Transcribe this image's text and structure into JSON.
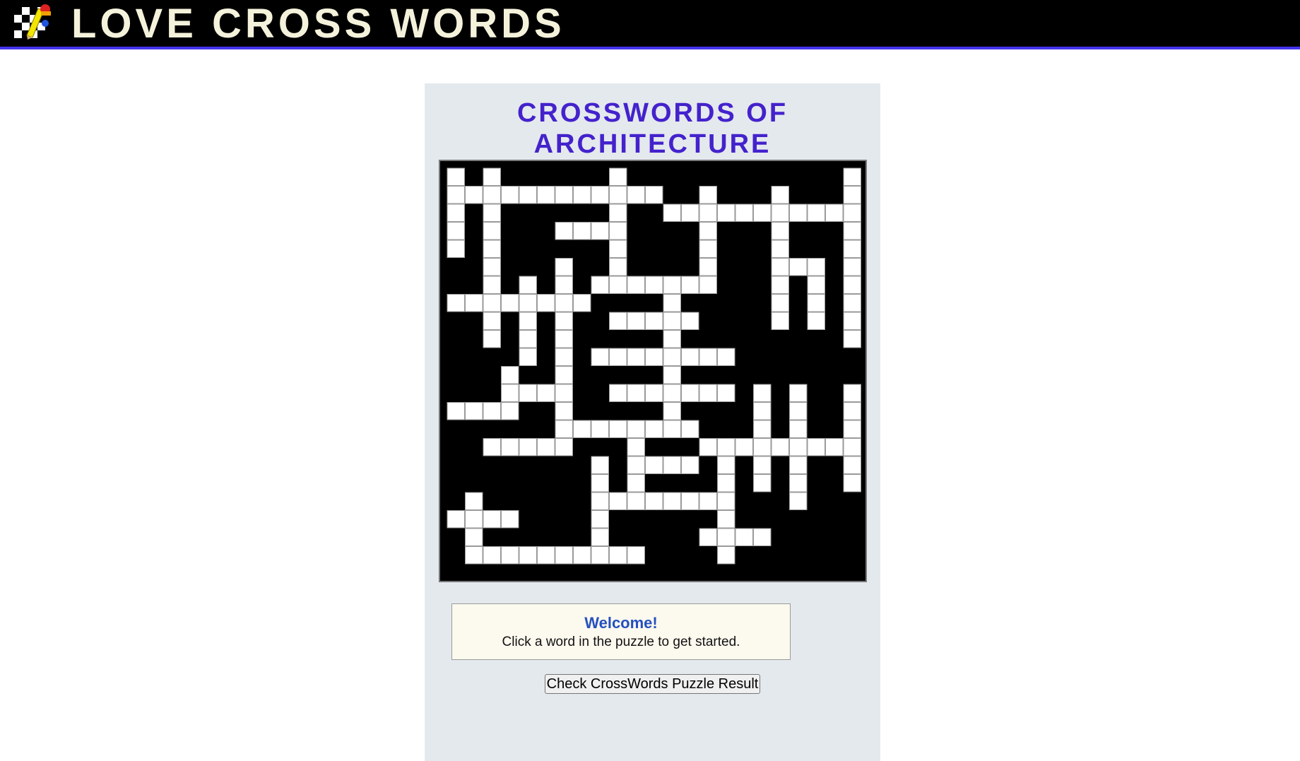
{
  "header": {
    "logo_icon": "checkered-flag-pencil-icon",
    "title": "LOVE CROSS WORDS",
    "title_color": "#f5f2dc",
    "background": "#000000",
    "accent": "#4433ee"
  },
  "puzzle": {
    "title_line1": "CROSSWORDS OF",
    "title_line2": "ARCHITECTURE",
    "title_color": "#4422cc",
    "grid_columns": 23,
    "grid_rows": 23,
    "rows": [
      "#.#......#..........#..",
      "..........#...#...#....",
      "........................",
      "....................#..",
      "#.#...##.#.#...#.#..#..",
      "..#..#.#.#.#.#.....##..",
      "..#.#.#........#.#.#..",
      "....#.#...#.....#.#.#..",
      "...",
      "",
      "",
      "",
      "",
      "",
      "",
      "",
      "",
      "",
      "",
      "",
      "",
      "",
      ""
    ],
    "white_cells": [
      [
        0,
        0
      ],
      [
        0,
        2
      ],
      [
        0,
        9
      ],
      [
        0,
        22
      ],
      [
        1,
        0
      ],
      [
        1,
        1
      ],
      [
        1,
        2
      ],
      [
        1,
        3
      ],
      [
        1,
        4
      ],
      [
        1,
        5
      ],
      [
        1,
        6
      ],
      [
        1,
        7
      ],
      [
        1,
        8
      ],
      [
        1,
        9
      ],
      [
        1,
        10
      ],
      [
        1,
        11
      ],
      [
        1,
        14
      ],
      [
        1,
        18
      ],
      [
        1,
        22
      ],
      [
        2,
        0
      ],
      [
        2,
        2
      ],
      [
        2,
        9
      ],
      [
        2,
        12
      ],
      [
        2,
        13
      ],
      [
        2,
        14
      ],
      [
        2,
        15
      ],
      [
        2,
        16
      ],
      [
        2,
        17
      ],
      [
        2,
        18
      ],
      [
        2,
        19
      ],
      [
        2,
        20
      ],
      [
        2,
        21
      ],
      [
        2,
        22
      ],
      [
        3,
        0
      ],
      [
        3,
        2
      ],
      [
        3,
        6
      ],
      [
        3,
        7
      ],
      [
        3,
        8
      ],
      [
        3,
        9
      ],
      [
        3,
        14
      ],
      [
        3,
        18
      ],
      [
        3,
        22
      ],
      [
        4,
        0
      ],
      [
        4,
        2
      ],
      [
        4,
        9
      ],
      [
        4,
        14
      ],
      [
        4,
        18
      ],
      [
        4,
        22
      ],
      [
        5,
        2
      ],
      [
        5,
        6
      ],
      [
        5,
        9
      ],
      [
        5,
        14
      ],
      [
        5,
        18
      ],
      [
        5,
        19
      ],
      [
        5,
        20
      ],
      [
        5,
        22
      ],
      [
        6,
        2
      ],
      [
        6,
        4
      ],
      [
        6,
        6
      ],
      [
        6,
        8
      ],
      [
        6,
        9
      ],
      [
        6,
        10
      ],
      [
        6,
        11
      ],
      [
        6,
        12
      ],
      [
        6,
        13
      ],
      [
        6,
        14
      ],
      [
        6,
        18
      ],
      [
        6,
        20
      ],
      [
        6,
        22
      ],
      [
        7,
        0
      ],
      [
        7,
        1
      ],
      [
        7,
        2
      ],
      [
        7,
        3
      ],
      [
        7,
        4
      ],
      [
        7,
        5
      ],
      [
        7,
        6
      ],
      [
        7,
        7
      ],
      [
        7,
        12
      ],
      [
        7,
        18
      ],
      [
        7,
        20
      ],
      [
        7,
        22
      ],
      [
        8,
        2
      ],
      [
        8,
        4
      ],
      [
        8,
        6
      ],
      [
        8,
        9
      ],
      [
        8,
        10
      ],
      [
        8,
        11
      ],
      [
        8,
        12
      ],
      [
        8,
        13
      ],
      [
        8,
        18
      ],
      [
        8,
        20
      ],
      [
        8,
        22
      ],
      [
        9,
        2
      ],
      [
        9,
        4
      ],
      [
        9,
        6
      ],
      [
        9,
        12
      ],
      [
        9,
        22
      ],
      [
        10,
        4
      ],
      [
        10,
        6
      ],
      [
        10,
        8
      ],
      [
        10,
        9
      ],
      [
        10,
        10
      ],
      [
        10,
        11
      ],
      [
        10,
        12
      ],
      [
        10,
        13
      ],
      [
        10,
        14
      ],
      [
        10,
        15
      ],
      [
        11,
        3
      ],
      [
        11,
        6
      ],
      [
        11,
        12
      ],
      [
        12,
        3
      ],
      [
        12,
        4
      ],
      [
        12,
        5
      ],
      [
        12,
        6
      ],
      [
        12,
        9
      ],
      [
        12,
        10
      ],
      [
        12,
        11
      ],
      [
        12,
        12
      ],
      [
        12,
        13
      ],
      [
        12,
        14
      ],
      [
        12,
        15
      ],
      [
        12,
        17
      ],
      [
        12,
        19
      ],
      [
        12,
        22
      ],
      [
        13,
        0
      ],
      [
        13,
        1
      ],
      [
        13,
        2
      ],
      [
        13,
        3
      ],
      [
        13,
        6
      ],
      [
        13,
        12
      ],
      [
        13,
        17
      ],
      [
        13,
        19
      ],
      [
        13,
        22
      ],
      [
        14,
        6
      ],
      [
        14,
        7
      ],
      [
        14,
        8
      ],
      [
        14,
        9
      ],
      [
        14,
        10
      ],
      [
        14,
        11
      ],
      [
        14,
        12
      ],
      [
        14,
        13
      ],
      [
        14,
        17
      ],
      [
        14,
        19
      ],
      [
        14,
        22
      ],
      [
        15,
        2
      ],
      [
        15,
        3
      ],
      [
        15,
        4
      ],
      [
        15,
        5
      ],
      [
        15,
        6
      ],
      [
        15,
        10
      ],
      [
        15,
        14
      ],
      [
        15,
        15
      ],
      [
        15,
        16
      ],
      [
        15,
        17
      ],
      [
        15,
        18
      ],
      [
        15,
        19
      ],
      [
        15,
        20
      ],
      [
        15,
        21
      ],
      [
        15,
        22
      ],
      [
        16,
        8
      ],
      [
        16,
        10
      ],
      [
        16,
        11
      ],
      [
        16,
        12
      ],
      [
        16,
        13
      ],
      [
        16,
        15
      ],
      [
        16,
        17
      ],
      [
        16,
        19
      ],
      [
        16,
        22
      ],
      [
        17,
        8
      ],
      [
        17,
        10
      ],
      [
        17,
        15
      ],
      [
        17,
        17
      ],
      [
        17,
        19
      ],
      [
        17,
        22
      ],
      [
        18,
        1
      ],
      [
        18,
        8
      ],
      [
        18,
        9
      ],
      [
        18,
        10
      ],
      [
        18,
        11
      ],
      [
        18,
        12
      ],
      [
        18,
        13
      ],
      [
        18,
        14
      ],
      [
        18,
        15
      ],
      [
        18,
        19
      ],
      [
        19,
        0
      ],
      [
        19,
        1
      ],
      [
        19,
        2
      ],
      [
        19,
        3
      ],
      [
        19,
        8
      ],
      [
        19,
        15
      ],
      [
        20,
        1
      ],
      [
        20,
        8
      ],
      [
        20,
        14
      ],
      [
        20,
        15
      ],
      [
        20,
        16
      ],
      [
        20,
        17
      ],
      [
        21,
        1
      ],
      [
        21,
        2
      ],
      [
        21,
        3
      ],
      [
        21,
        4
      ],
      [
        21,
        5
      ],
      [
        21,
        6
      ],
      [
        21,
        7
      ],
      [
        21,
        8
      ],
      [
        21,
        9
      ],
      [
        21,
        10
      ],
      [
        21,
        15
      ]
    ]
  },
  "message": {
    "title": "Welcome!",
    "text": "Click a word in the puzzle to get started."
  },
  "actions": {
    "check_label": "Check CrossWords Puzzle Result"
  }
}
